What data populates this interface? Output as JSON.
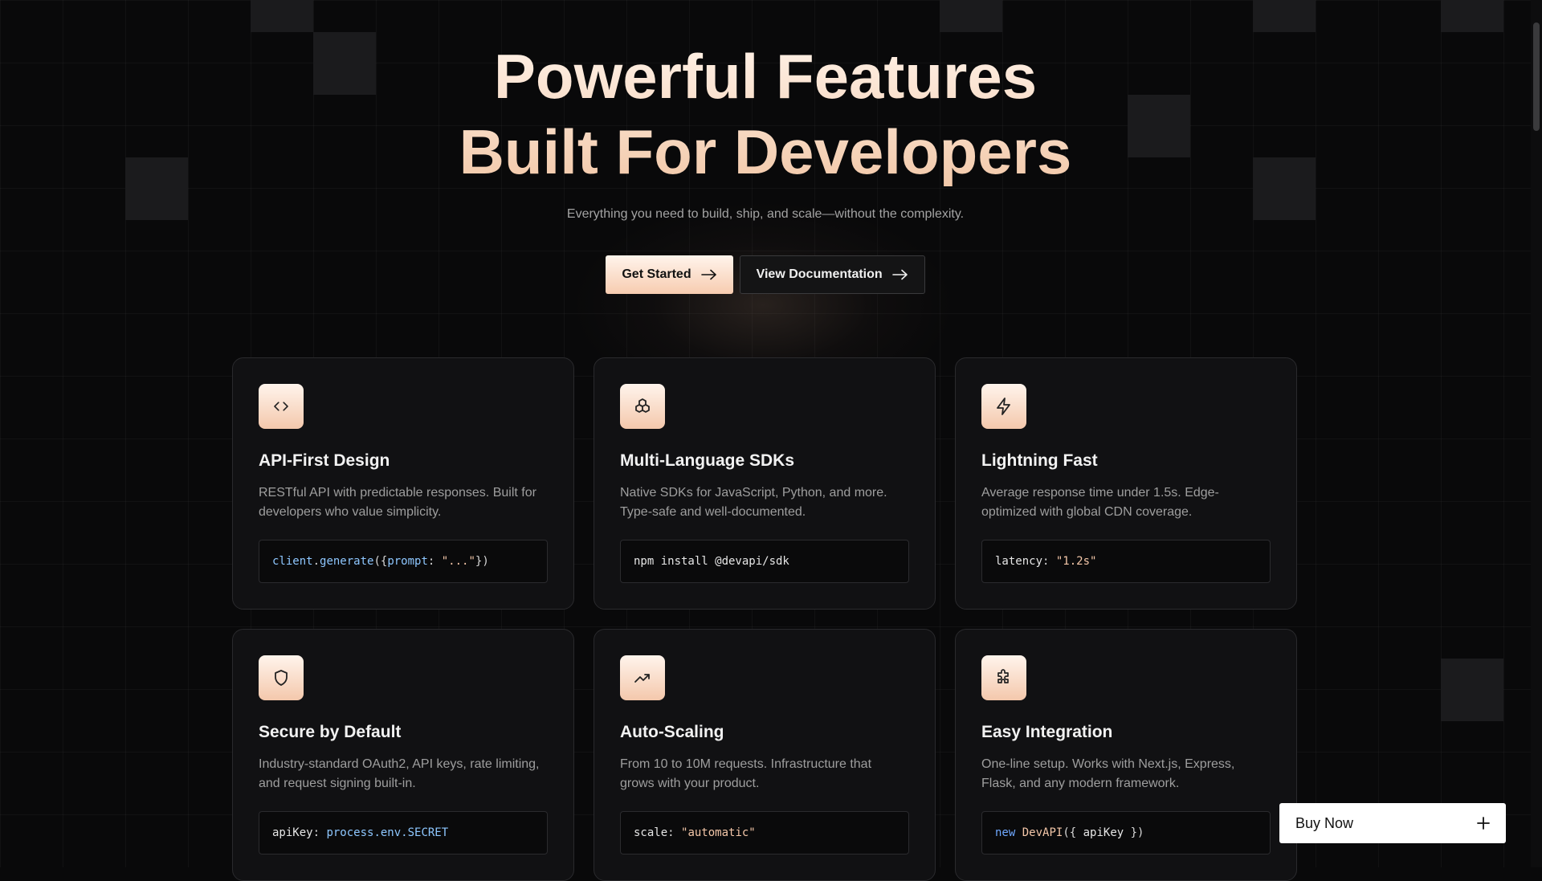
{
  "hero": {
    "title_line1": "Powerful Features",
    "title_line2": "Built For Developers",
    "subtitle": "Everything you need to build, ship, and scale—without the complexity.",
    "primary_button": "Get Started",
    "secondary_button": "View Documentation"
  },
  "features": [
    {
      "icon": "code-icon",
      "title": "API-First Design",
      "description": "RESTful API with predictable responses. Built for developers who value simplicity.",
      "code": [
        "client",
        ".",
        "generate",
        "({",
        "prompt",
        ": ",
        "\"...\"",
        "})"
      ]
    },
    {
      "icon": "layers-icon",
      "title": "Multi-Language SDKs",
      "description": "Native SDKs for JavaScript, Python, and more. Type-safe and well-documented.",
      "code": [
        "npm install @devapi/sdk"
      ]
    },
    {
      "icon": "lightning-icon",
      "title": "Lightning Fast",
      "description": "Average response time under 1.5s. Edge-optimized with global CDN coverage.",
      "code": [
        "latency",
        ": ",
        "\"1.2s\""
      ]
    },
    {
      "icon": "shield-icon",
      "title": "Secure by Default",
      "description": "Industry-standard OAuth2, API keys, rate limiting, and request signing built-in.",
      "code": [
        "apiKey",
        ": ",
        "process.env.SECRET"
      ]
    },
    {
      "icon": "trending-up-icon",
      "title": "Auto-Scaling",
      "description": "From 10 to 10M requests. Infrastructure that grows with your product.",
      "code": [
        "scale",
        ": ",
        "\"automatic\""
      ]
    },
    {
      "icon": "puzzle-icon",
      "title": "Easy Integration",
      "description": "One-line setup. Works with Next.js, Express, Flask, and any modern framework.",
      "code": [
        "new",
        " ",
        "DevAPI",
        "({ ",
        "apiKey",
        " })"
      ]
    }
  ],
  "buy_widget": {
    "label": "Buy Now",
    "icon": "plus-icon"
  },
  "colors": {
    "background": "#09090a",
    "accent": "#f7ccb0",
    "card": "#111113"
  }
}
